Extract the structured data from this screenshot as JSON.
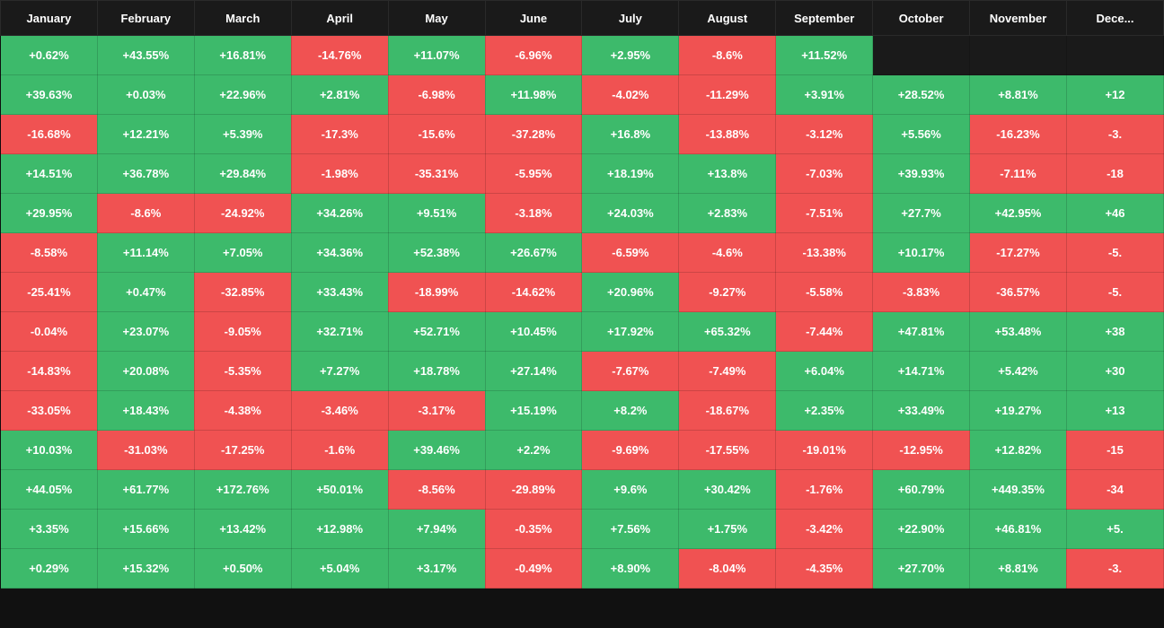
{
  "headers": [
    "January",
    "February",
    "March",
    "April",
    "May",
    "June",
    "July",
    "August",
    "September",
    "October",
    "November",
    "Dece..."
  ],
  "rows": [
    [
      "+0.62%",
      "+43.55%",
      "+16.81%",
      "-14.76%",
      "+11.07%",
      "-6.96%",
      "+2.95%",
      "-8.6%",
      "+11.52%",
      "",
      "",
      ""
    ],
    [
      "+39.63%",
      "+0.03%",
      "+22.96%",
      "+2.81%",
      "-6.98%",
      "+11.98%",
      "-4.02%",
      "-11.29%",
      "+3.91%",
      "+28.52%",
      "+8.81%",
      "+12"
    ],
    [
      "-16.68%",
      "+12.21%",
      "+5.39%",
      "-17.3%",
      "-15.6%",
      "-37.28%",
      "+16.8%",
      "-13.88%",
      "-3.12%",
      "+5.56%",
      "-16.23%",
      "-3."
    ],
    [
      "+14.51%",
      "+36.78%",
      "+29.84%",
      "-1.98%",
      "-35.31%",
      "-5.95%",
      "+18.19%",
      "+13.8%",
      "-7.03%",
      "+39.93%",
      "-7.11%",
      "-18"
    ],
    [
      "+29.95%",
      "-8.6%",
      "-24.92%",
      "+34.26%",
      "+9.51%",
      "-3.18%",
      "+24.03%",
      "+2.83%",
      "-7.51%",
      "+27.7%",
      "+42.95%",
      "+46"
    ],
    [
      "-8.58%",
      "+11.14%",
      "+7.05%",
      "+34.36%",
      "+52.38%",
      "+26.67%",
      "-6.59%",
      "-4.6%",
      "-13.38%",
      "+10.17%",
      "-17.27%",
      "-5."
    ],
    [
      "-25.41%",
      "+0.47%",
      "-32.85%",
      "+33.43%",
      "-18.99%",
      "-14.62%",
      "+20.96%",
      "-9.27%",
      "-5.58%",
      "-3.83%",
      "-36.57%",
      "-5."
    ],
    [
      "-0.04%",
      "+23.07%",
      "-9.05%",
      "+32.71%",
      "+52.71%",
      "+10.45%",
      "+17.92%",
      "+65.32%",
      "-7.44%",
      "+47.81%",
      "+53.48%",
      "+38"
    ],
    [
      "-14.83%",
      "+20.08%",
      "-5.35%",
      "+7.27%",
      "+18.78%",
      "+27.14%",
      "-7.67%",
      "-7.49%",
      "+6.04%",
      "+14.71%",
      "+5.42%",
      "+30"
    ],
    [
      "-33.05%",
      "+18.43%",
      "-4.38%",
      "-3.46%",
      "-3.17%",
      "+15.19%",
      "+8.2%",
      "-18.67%",
      "+2.35%",
      "+33.49%",
      "+19.27%",
      "+13"
    ],
    [
      "+10.03%",
      "-31.03%",
      "-17.25%",
      "-1.6%",
      "+39.46%",
      "+2.2%",
      "-9.69%",
      "-17.55%",
      "-19.01%",
      "-12.95%",
      "+12.82%",
      "-15"
    ],
    [
      "+44.05%",
      "+61.77%",
      "+172.76%",
      "+50.01%",
      "-8.56%",
      "-29.89%",
      "+9.6%",
      "+30.42%",
      "-1.76%",
      "+60.79%",
      "+449.35%",
      "-34"
    ],
    [
      "+3.35%",
      "+15.66%",
      "+13.42%",
      "+12.98%",
      "+7.94%",
      "-0.35%",
      "+7.56%",
      "+1.75%",
      "-3.42%",
      "+22.90%",
      "+46.81%",
      "+5."
    ],
    [
      "+0.29%",
      "+15.32%",
      "+0.50%",
      "+5.04%",
      "+3.17%",
      "-0.49%",
      "+8.90%",
      "-8.04%",
      "-4.35%",
      "+27.70%",
      "+8.81%",
      "-3."
    ]
  ]
}
